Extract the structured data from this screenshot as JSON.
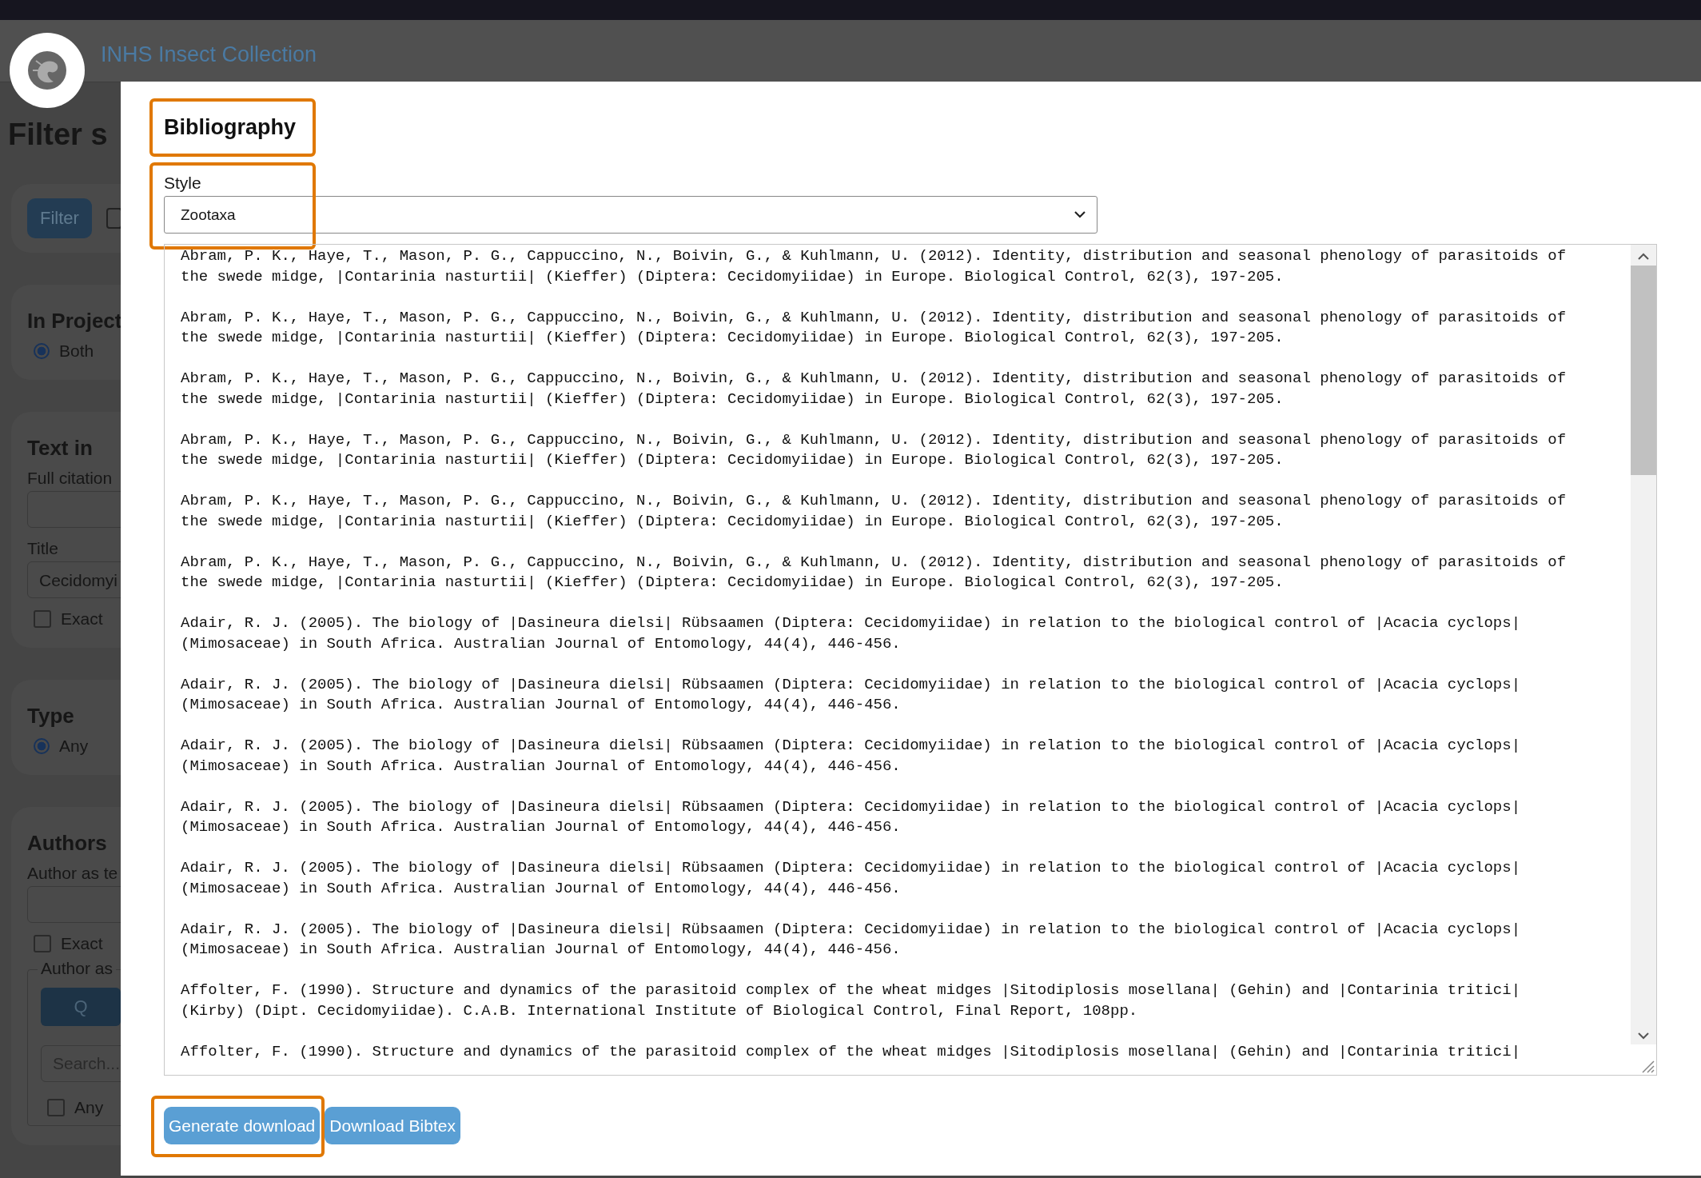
{
  "header": {
    "site_title": "INHS Insect Collection"
  },
  "background_panel": {
    "heading": "Filter s",
    "filter_button": "Filter",
    "filter_checkbox": {
      "checked": false
    },
    "cards": [
      {
        "title": "In Project",
        "items": [
          {
            "kind": "radio",
            "label": "Both",
            "selected": true
          }
        ]
      },
      {
        "title": "Text in",
        "items": [
          {
            "kind": "label",
            "text": "Full citation"
          },
          {
            "kind": "input"
          },
          {
            "kind": "label",
            "text": "Title"
          },
          {
            "kind": "input",
            "value": "Cecidomyi"
          },
          {
            "kind": "checkbox",
            "label": "Exact",
            "checked": false
          }
        ]
      },
      {
        "title": "Type",
        "items": [
          {
            "kind": "radio",
            "label": "Any",
            "selected": true
          }
        ]
      },
      {
        "title": "Authors",
        "items": [
          {
            "kind": "label",
            "text": "Author as te"
          },
          {
            "kind": "input"
          },
          {
            "kind": "checkbox",
            "label": "Exact",
            "checked": false
          },
          {
            "kind": "fieldset",
            "legend": "Author as",
            "button": "Q",
            "placeholder": "Search...",
            "checkbox": {
              "label": "Any",
              "checked": false
            }
          }
        ]
      }
    ]
  },
  "modal": {
    "title": {
      "text": "Bibliography",
      "highlighted": true
    },
    "style_field": {
      "label": "Style",
      "value": "Zootaxa",
      "highlighted": true
    },
    "entries": [
      "Abram, P. K., Haye, T., Mason, P. G., Cappuccino, N., Boivin, G., & Kuhlmann, U. (2012). Identity, distribution and seasonal phenology of parasitoids of\nthe swede midge, |Contarinia nasturtii| (Kieffer) (Diptera: Cecidomyiidae) in Europe. Biological Control, 62(3), 197-205.",
      "Abram, P. K., Haye, T., Mason, P. G., Cappuccino, N., Boivin, G., & Kuhlmann, U. (2012). Identity, distribution and seasonal phenology of parasitoids of\nthe swede midge, |Contarinia nasturtii| (Kieffer) (Diptera: Cecidomyiidae) in Europe. Biological Control, 62(3), 197-205.",
      "Abram, P. K., Haye, T., Mason, P. G., Cappuccino, N., Boivin, G., & Kuhlmann, U. (2012). Identity, distribution and seasonal phenology of parasitoids of\nthe swede midge, |Contarinia nasturtii| (Kieffer) (Diptera: Cecidomyiidae) in Europe. Biological Control, 62(3), 197-205.",
      "Abram, P. K., Haye, T., Mason, P. G., Cappuccino, N., Boivin, G., & Kuhlmann, U. (2012). Identity, distribution and seasonal phenology of parasitoids of\nthe swede midge, |Contarinia nasturtii| (Kieffer) (Diptera: Cecidomyiidae) in Europe. Biological Control, 62(3), 197-205.",
      "Abram, P. K., Haye, T., Mason, P. G., Cappuccino, N., Boivin, G., & Kuhlmann, U. (2012). Identity, distribution and seasonal phenology of parasitoids of\nthe swede midge, |Contarinia nasturtii| (Kieffer) (Diptera: Cecidomyiidae) in Europe. Biological Control, 62(3), 197-205.",
      "Abram, P. K., Haye, T., Mason, P. G., Cappuccino, N., Boivin, G., & Kuhlmann, U. (2012). Identity, distribution and seasonal phenology of parasitoids of\nthe swede midge, |Contarinia nasturtii| (Kieffer) (Diptera: Cecidomyiidae) in Europe. Biological Control, 62(3), 197-205.",
      "Adair, R. J. (2005). The biology of |Dasineura dielsi| Rübsaamen (Diptera: Cecidomyiidae) in relation to the biological control of |Acacia cyclops|\n(Mimosaceae) in South Africa. Australian Journal of Entomology, 44(4), 446-456.",
      "Adair, R. J. (2005). The biology of |Dasineura dielsi| Rübsaamen (Diptera: Cecidomyiidae) in relation to the biological control of |Acacia cyclops|\n(Mimosaceae) in South Africa. Australian Journal of Entomology, 44(4), 446-456.",
      "Adair, R. J. (2005). The biology of |Dasineura dielsi| Rübsaamen (Diptera: Cecidomyiidae) in relation to the biological control of |Acacia cyclops|\n(Mimosaceae) in South Africa. Australian Journal of Entomology, 44(4), 446-456.",
      "Adair, R. J. (2005). The biology of |Dasineura dielsi| Rübsaamen (Diptera: Cecidomyiidae) in relation to the biological control of |Acacia cyclops|\n(Mimosaceae) in South Africa. Australian Journal of Entomology, 44(4), 446-456.",
      "Adair, R. J. (2005). The biology of |Dasineura dielsi| Rübsaamen (Diptera: Cecidomyiidae) in relation to the biological control of |Acacia cyclops|\n(Mimosaceae) in South Africa. Australian Journal of Entomology, 44(4), 446-456.",
      "Adair, R. J. (2005). The biology of |Dasineura dielsi| Rübsaamen (Diptera: Cecidomyiidae) in relation to the biological control of |Acacia cyclops|\n(Mimosaceae) in South Africa. Australian Journal of Entomology, 44(4), 446-456.",
      "Affolter, F. (1990). Structure and dynamics of the parasitoid complex of the wheat midges |Sitodiplosis mosellana| (Gehin) and |Contarinia tritici|\n(Kirby) (Dipt. Cecidomyiidae). C.A.B. International Institute of Biological Control, Final Report, 108pp.",
      "Affolter, F. (1990). Structure and dynamics of the parasitoid complex of the wheat midges |Sitodiplosis mosellana| (Gehin) and |Contarinia tritici|"
    ],
    "buttons": [
      {
        "label": "Generate download",
        "highlighted": true
      },
      {
        "label": "Download Bibtex",
        "highlighted": false
      }
    ]
  }
}
